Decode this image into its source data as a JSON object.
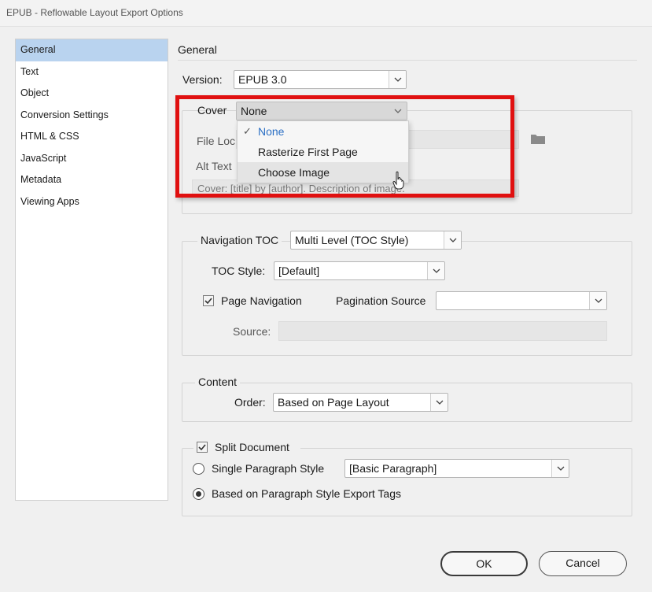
{
  "window": {
    "title": "EPUB - Reflowable Layout Export Options"
  },
  "sidebar": {
    "items": [
      {
        "label": "General",
        "selected": true
      },
      {
        "label": "Text"
      },
      {
        "label": "Object"
      },
      {
        "label": "Conversion Settings"
      },
      {
        "label": "HTML & CSS"
      },
      {
        "label": "JavaScript"
      },
      {
        "label": "Metadata"
      },
      {
        "label": "Viewing Apps"
      }
    ]
  },
  "general": {
    "title": "General",
    "version": {
      "label": "Version:",
      "value": "EPUB 3.0"
    },
    "cover": {
      "label": "Cover",
      "value": "None",
      "file_location_label": "File Loc",
      "alt_text_label": "Alt Text",
      "alt_text_value": "Cover: [title] by [author]. Description of image.",
      "menu": {
        "options": [
          {
            "label": "None",
            "selected": true
          },
          {
            "label": "Rasterize First Page"
          },
          {
            "label": "Choose Image",
            "hover": true
          }
        ]
      }
    },
    "navigation": {
      "label": "Navigation TOC",
      "value": "Multi Level (TOC Style)",
      "toc_style_label": "TOC Style:",
      "toc_style_value": "[Default]",
      "page_navigation_label": "Page Navigation",
      "page_navigation_checked": true,
      "pagination_source_label": "Pagination Source",
      "pagination_source_value": "",
      "source_label": "Source:"
    },
    "content": {
      "title": "Content",
      "order_label": "Order:",
      "order_value": "Based on Page Layout"
    },
    "split": {
      "label": "Split Document",
      "checked": true,
      "single_paragraph_label": "Single Paragraph Style",
      "single_paragraph_value": "[Basic Paragraph]",
      "export_tags_label": "Based on Paragraph Style Export Tags",
      "selected_option": "export_tags"
    }
  },
  "buttons": {
    "ok": "OK",
    "cancel": "Cancel"
  },
  "colors": {
    "highlight": "#e01010",
    "selection": "#b9d3ef",
    "menu_selected": "#2b6fc4"
  }
}
